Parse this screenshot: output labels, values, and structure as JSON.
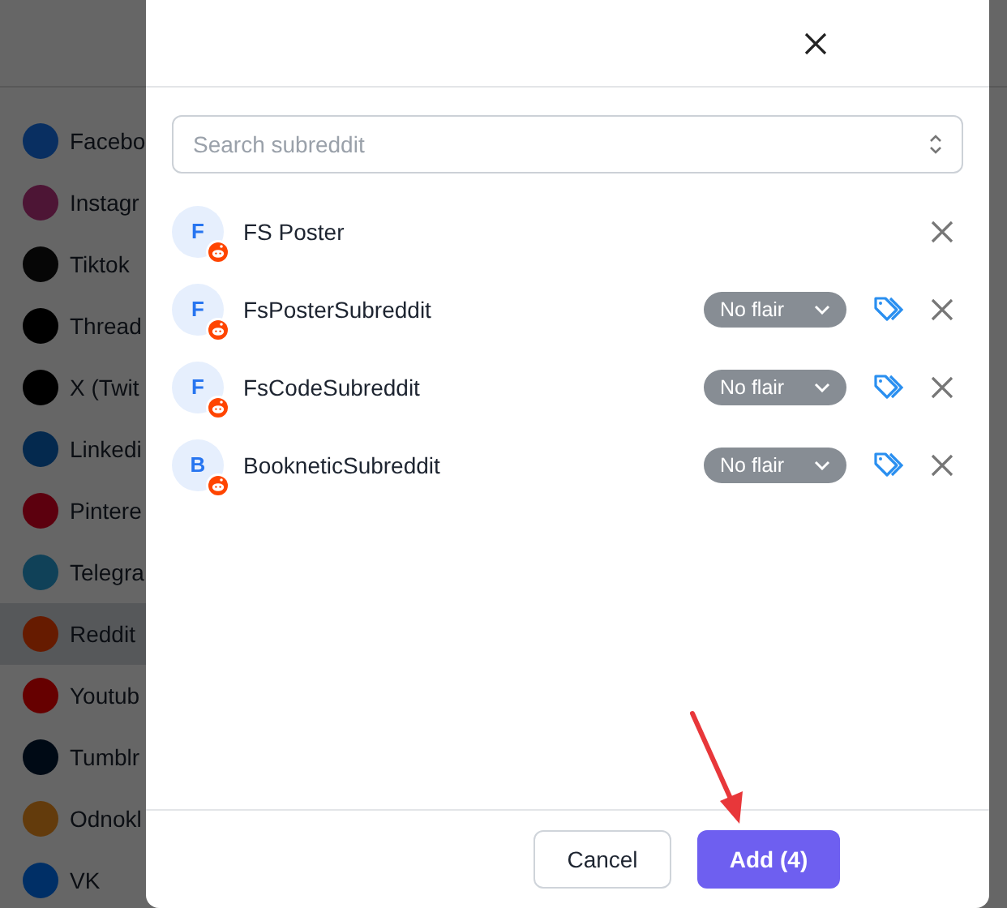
{
  "background": {
    "sidebar": {
      "items": [
        {
          "label": "Facebo",
          "kind": "facebook",
          "selected": false
        },
        {
          "label": "Instagr",
          "kind": "instagram",
          "selected": false
        },
        {
          "label": "Tiktok",
          "kind": "tiktok",
          "selected": false
        },
        {
          "label": "Thread",
          "kind": "threads",
          "selected": false
        },
        {
          "label": "X (Twit",
          "kind": "x",
          "selected": false
        },
        {
          "label": "Linkedi",
          "kind": "linkedin",
          "selected": false
        },
        {
          "label": "Pintere",
          "kind": "pinterest",
          "selected": false
        },
        {
          "label": "Telegra",
          "kind": "telegram",
          "selected": false
        },
        {
          "label": "Reddit",
          "kind": "reddit",
          "selected": true
        },
        {
          "label": "Youtub",
          "kind": "youtube",
          "selected": false
        },
        {
          "label": "Tumblr",
          "kind": "tumblr",
          "selected": false
        },
        {
          "label": "Odnokl",
          "kind": "odnoklassniki",
          "selected": false
        },
        {
          "label": "VK",
          "kind": "vk",
          "selected": false
        }
      ]
    }
  },
  "modal": {
    "search": {
      "placeholder": "Search subreddit"
    },
    "subreddits": [
      {
        "initial": "F",
        "name": "FS Poster"
      },
      {
        "initial": "F",
        "name": "FsPosterSubreddit",
        "flair": "No flair"
      },
      {
        "initial": "F",
        "name": "FsCodeSubreddit",
        "flair": "No flair"
      },
      {
        "initial": "B",
        "name": "BookneticSubreddit",
        "flair": "No flair"
      }
    ],
    "buttons": [
      {
        "label": "Cancel",
        "kind": "secondary"
      },
      {
        "label": "Add (4)",
        "kind": "primary"
      }
    ]
  }
}
